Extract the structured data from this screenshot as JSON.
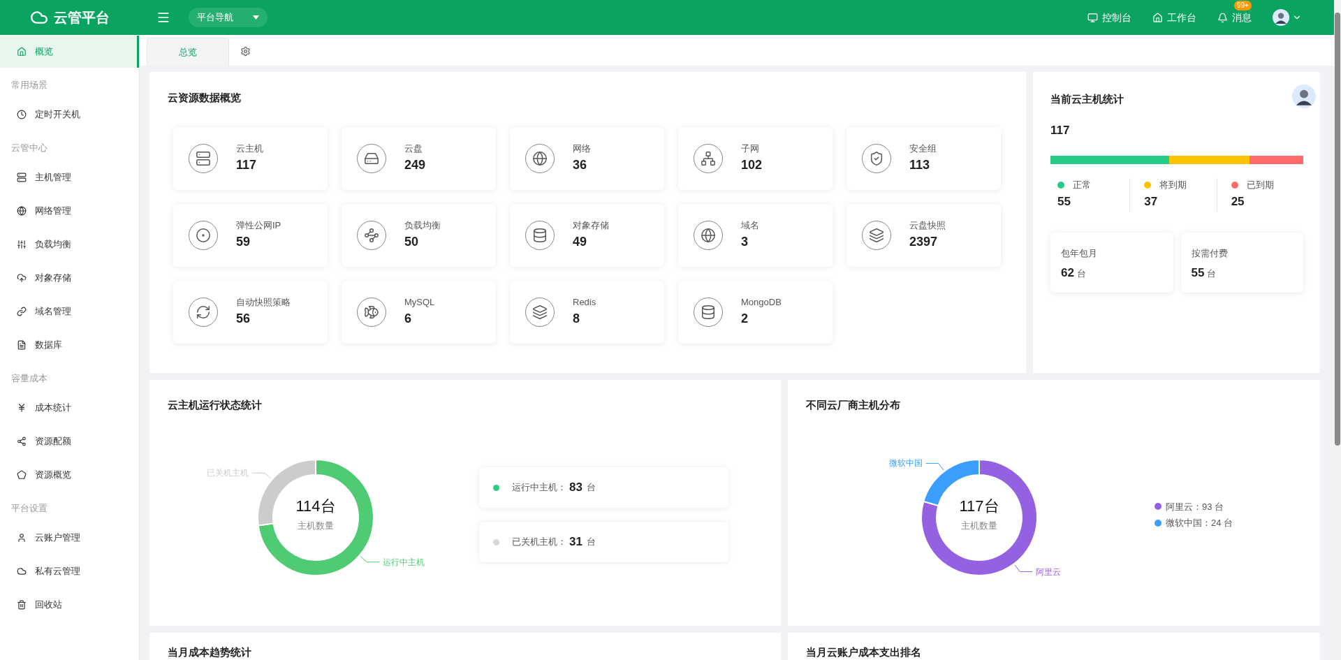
{
  "header": {
    "logo": "云管平台",
    "nav_dropdown": "平台导航",
    "links": [
      {
        "label": "控制台"
      },
      {
        "label": "工作台"
      },
      {
        "label": "消息",
        "badge": "99+"
      }
    ]
  },
  "sidebar": {
    "items": [
      {
        "kind": "item",
        "label": "概览",
        "selected": true
      },
      {
        "kind": "group",
        "label": "常用场景"
      },
      {
        "kind": "item",
        "label": "定时开关机",
        "selected": false
      },
      {
        "kind": "group",
        "label": "云管中心"
      },
      {
        "kind": "item",
        "label": "主机管理",
        "selected": false
      },
      {
        "kind": "item",
        "label": "网络管理",
        "selected": false
      },
      {
        "kind": "item",
        "label": "负载均衡",
        "selected": false
      },
      {
        "kind": "item",
        "label": "对象存储",
        "selected": false
      },
      {
        "kind": "item",
        "label": "域名管理",
        "selected": false
      },
      {
        "kind": "item",
        "label": "数据库",
        "selected": false
      },
      {
        "kind": "group",
        "label": "容量成本"
      },
      {
        "kind": "item",
        "label": "成本统计",
        "selected": false
      },
      {
        "kind": "item",
        "label": "资源配额",
        "selected": false
      },
      {
        "kind": "item",
        "label": "资源概览",
        "selected": false
      },
      {
        "kind": "group",
        "label": "平台设置"
      },
      {
        "kind": "item",
        "label": "云账户管理",
        "selected": false
      },
      {
        "kind": "item",
        "label": "私有云管理",
        "selected": false
      },
      {
        "kind": "item",
        "label": "回收站",
        "selected": false
      }
    ]
  },
  "tabs": [
    {
      "label": "总览",
      "selected": true
    }
  ],
  "resource_overview": {
    "title": "云资源数据概览",
    "items": [
      {
        "label": "云主机",
        "value": "117"
      },
      {
        "label": "云盘",
        "value": "249"
      },
      {
        "label": "网络",
        "value": "36"
      },
      {
        "label": "子网",
        "value": "102"
      },
      {
        "label": "安全组",
        "value": "113"
      },
      {
        "label": "弹性公网IP",
        "value": "59"
      },
      {
        "label": "负载均衡",
        "value": "50"
      },
      {
        "label": "对象存储",
        "value": "49"
      },
      {
        "label": "域名",
        "value": "3"
      },
      {
        "label": "云盘快照",
        "value": "2397"
      },
      {
        "label": "自动快照策略",
        "value": "56"
      },
      {
        "label": "MySQL",
        "value": "6"
      },
      {
        "label": "Redis",
        "value": "8"
      },
      {
        "label": "MongoDB",
        "value": "2"
      }
    ]
  },
  "host_stats": {
    "title": "当前云主机统计",
    "total": "117",
    "statuses": [
      {
        "label": "正常",
        "value": "55",
        "color": "#26cc86"
      },
      {
        "label": "将到期",
        "value": "37",
        "color": "#fdc300"
      },
      {
        "label": "已到期",
        "value": "25",
        "color": "#ff6b6b"
      }
    ],
    "billing": [
      {
        "label": "包年包月",
        "value": "62",
        "unit": "台"
      },
      {
        "label": "按需付费",
        "value": "55",
        "unit": "台"
      }
    ]
  },
  "run_status": {
    "title": "云主机运行状态统计",
    "center_value": "114台",
    "chart_data": {
      "type": "donut",
      "categories": [
        "运行中主机",
        "已关机主机"
      ],
      "series": [
        {
          "name": "主机数量",
          "values": [
            72.81,
            27.19
          ]
        }
      ],
      "colors": [
        "#4fcb74",
        "#cccccc"
      ]
    },
    "legend": [
      {
        "label": "运行中主机：",
        "value": "83",
        "unit": "台",
        "color": "#2ecc87"
      },
      {
        "label": "已关机主机：",
        "value": "31",
        "unit": "台",
        "color": "#d5d8dd"
      }
    ]
  },
  "vendor_distribution": {
    "title": "不同云厂商主机分布",
    "center_value": "117台",
    "chart_data": {
      "type": "donut",
      "categories": [
        "阿里云",
        "微软中国"
      ],
      "series": [
        {
          "name": "主机数量",
          "values": [
            79.49,
            20.51
          ]
        }
      ],
      "colors": [
        "#9461e3",
        "#3a9ffc"
      ]
    },
    "legend": [
      {
        "text": "阿里云：93 台",
        "color": "#9461e3"
      },
      {
        "text": "微软中国：24 台",
        "color": "#3a9ffc"
      }
    ]
  },
  "cost_trend": {
    "title": "当月成本趋势统计"
  },
  "account_cost_ranking": {
    "title": "当月云账户成本支出排名"
  }
}
